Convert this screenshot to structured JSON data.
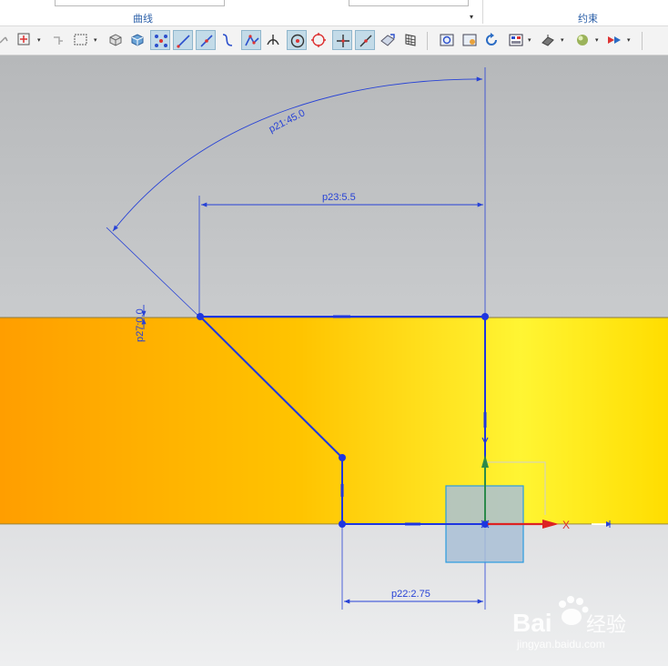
{
  "ribbon": {
    "curve_group_label": "曲线",
    "constraint_group_label": "约束",
    "dropdown_glyph": "▾"
  },
  "toolbar": {
    "dropdown_glyph": "▾",
    "icons": [
      "snap-icon",
      "sketch-point-icon",
      "move-icon",
      "selection-box-icon",
      "cube-icon",
      "solid-view-icon",
      "point-grid-icon",
      "line-icon",
      "line-tangent-icon",
      "spline-icon",
      "polygon-icon",
      "perpendicular-icon",
      "point-on-circle-icon",
      "circle-point-icon",
      "intersection-icon",
      "slope-line-icon",
      "surface-icon",
      "grid-icon",
      "view-fit-icon",
      "view-image-icon",
      "refresh-icon",
      "layout-icon",
      "shading-icon",
      "sphere-icon",
      "filter-icon"
    ]
  },
  "sketch": {
    "dimensions": {
      "angle": "p21:45.0",
      "width_top": "p23:5.5",
      "vertical_offset": "p27:0.0",
      "width_bottom": "p22:2.75"
    },
    "axes": {
      "x_label": "X"
    }
  },
  "colors": {
    "accent": "#2742d6",
    "top_background": "#c5c6c8",
    "bottom_background": "#dfe0e2",
    "orange_band_start": "#ff9e00",
    "orange_band_end": "#fff533",
    "csys_square": "#a9bfd6"
  },
  "watermark": {
    "brand": "Bai",
    "brand_suffix": "经验",
    "url": "jingyan.baidu.com"
  }
}
